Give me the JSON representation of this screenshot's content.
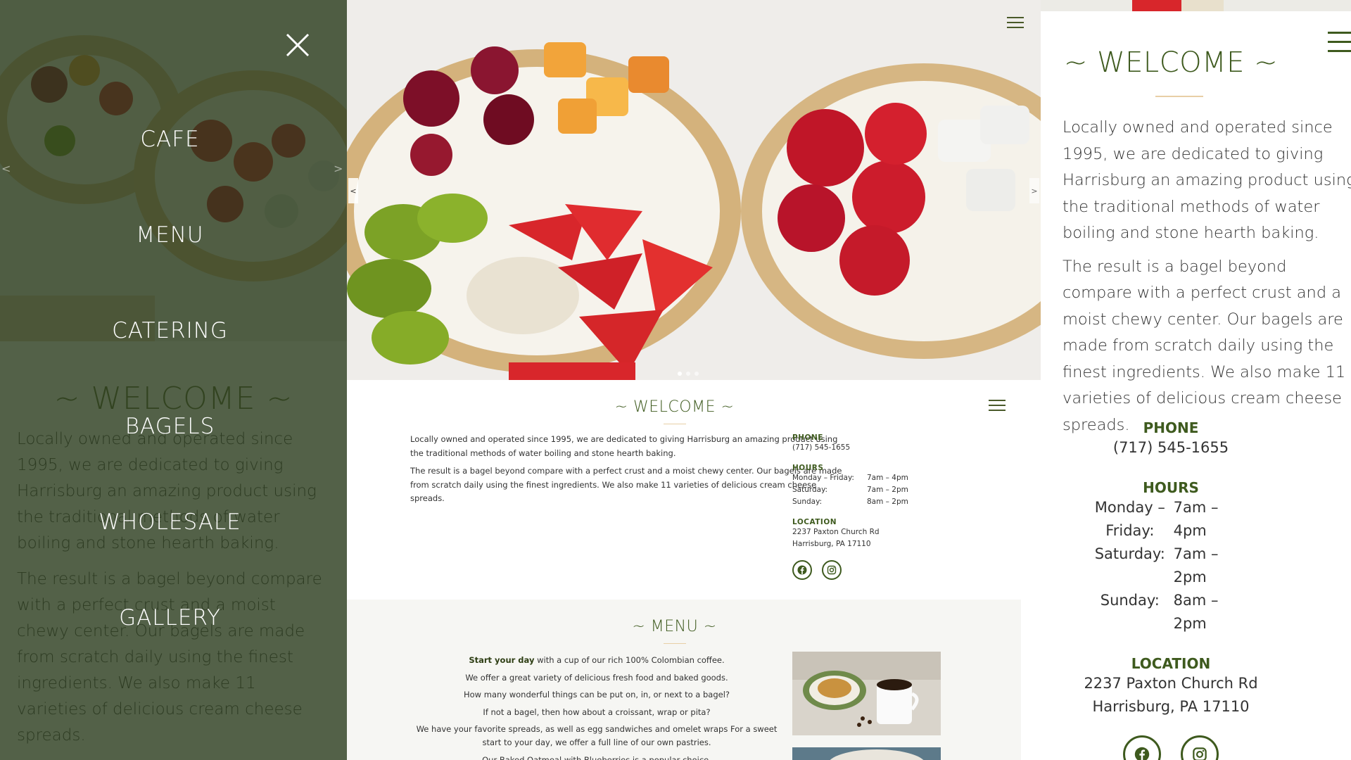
{
  "nav": {
    "items": [
      {
        "label": "CAFE"
      },
      {
        "label": "MENU"
      },
      {
        "label": "CATERING"
      },
      {
        "label": "BAGELS"
      },
      {
        "label": "WHOLESALE"
      },
      {
        "label": "GALLERY"
      }
    ]
  },
  "carousel": {
    "prev": "<",
    "next": ">"
  },
  "welcome": {
    "title": "~ WELCOME ~",
    "paragraph_1": "Locally owned and operated since 1995, we are dedicated to giving Harrisburg an amazing product using the traditional methods of water boiling and stone hearth baking.",
    "paragraph_2": "The result is a bagel beyond compare with a perfect crust and a moist chewy center. Our bagels are made from scratch daily using the finest ingredients. We also make 11 varieties of delicious cream cheese spreads."
  },
  "info": {
    "phone_heading": "PHONE",
    "phone": "(717) 545-1655",
    "hours_heading": "HOURS",
    "hours": [
      {
        "day": "Monday – Friday:",
        "time": "7am – 4pm"
      },
      {
        "day": "Saturday:",
        "time": "7am – 2pm"
      },
      {
        "day": "Sunday:",
        "time": "8am – 2pm"
      }
    ],
    "location_heading": "LOCATION",
    "address_line_1": "2237 Paxton Church Rd",
    "address_line_2": "Harrisburg, PA 17110"
  },
  "menu_section": {
    "title": "~ MENU ~",
    "line_1_bold": "Start your day",
    "line_1_rest": " with a cup of our rich 100% Colombian coffee.",
    "line_2": "We offer a great variety of delicious fresh food and baked goods.",
    "line_3": "How many wonderful things can be put on, in, or next to a bagel?",
    "line_4": "If not a bagel, then how about a croissant, wrap or pita?",
    "line_5": "We have your favorite spreads, as well as egg sandwiches and omelet wraps For a sweet start to your day, we offer a full line of our own pastries.",
    "line_6": "Our Baked Oatmeal with Blueberries is a popular choice."
  },
  "colors": {
    "brand_green": "#3e5a1e",
    "overlay_green": "#283a1a",
    "accent_rule": "#e8cfa6"
  }
}
